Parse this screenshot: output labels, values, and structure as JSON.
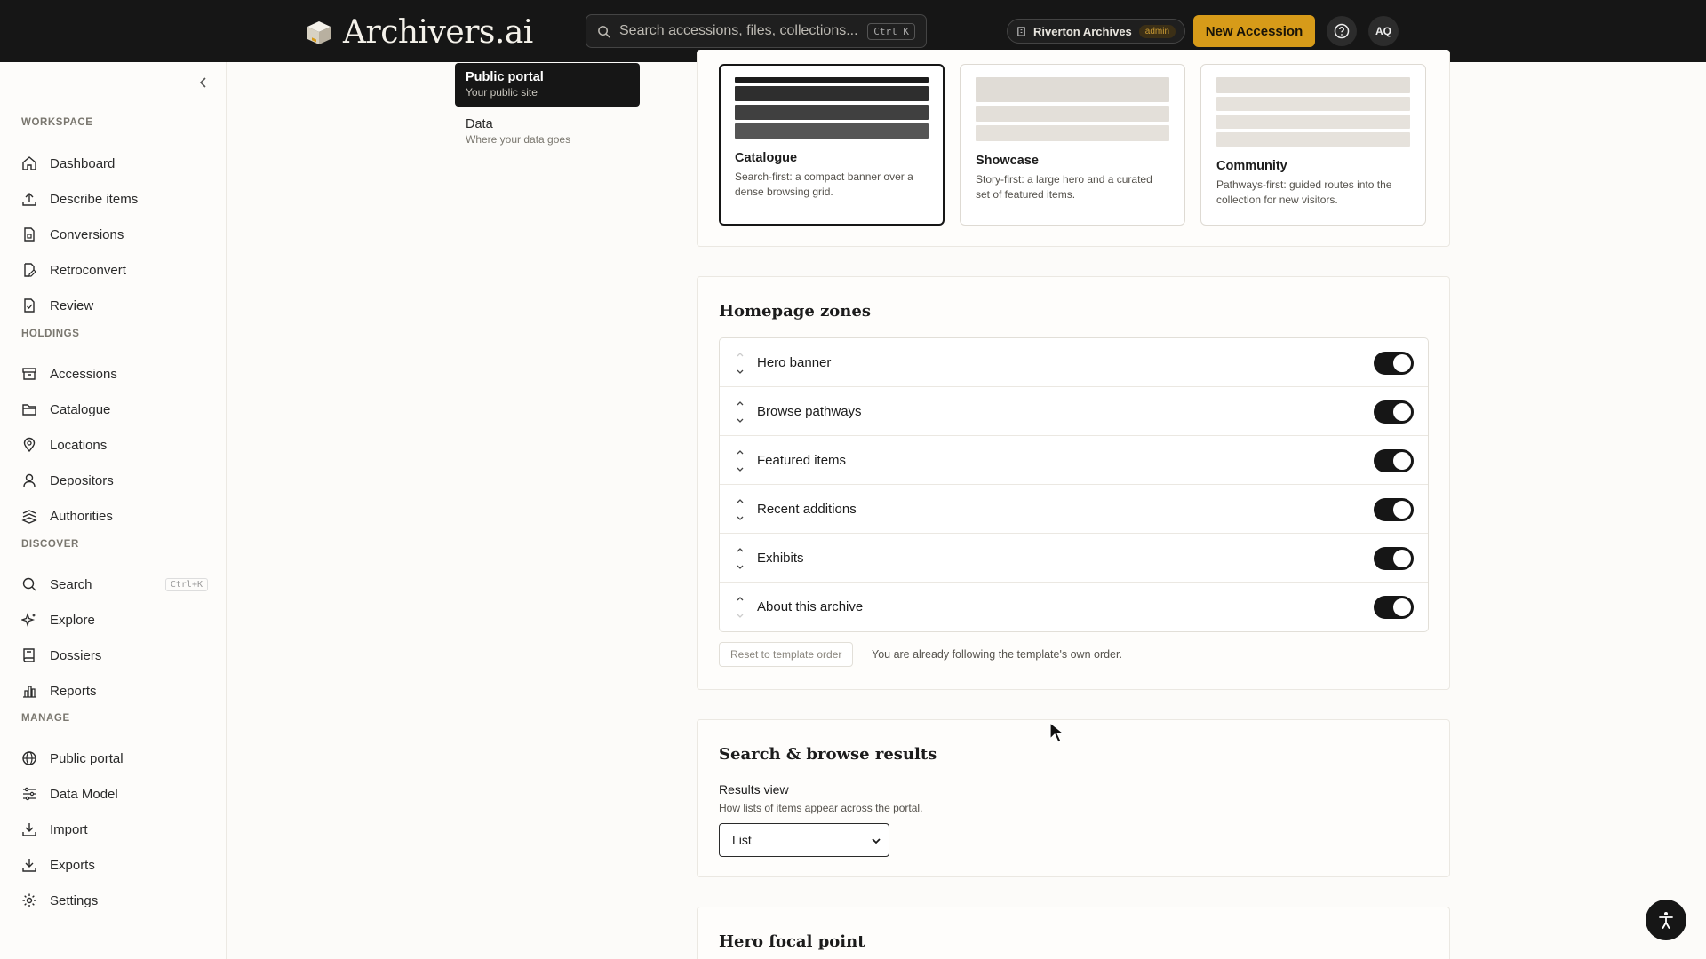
{
  "brand": {
    "name": "Archivers.ai"
  },
  "search": {
    "placeholder": "Search accessions, files, collections...",
    "shortcut": "Ctrl K"
  },
  "org": {
    "name": "Riverton Archives",
    "role": "admin"
  },
  "header": {
    "new_accession": "New Accession",
    "avatar_initials": "AQ"
  },
  "sidebar": {
    "sections": {
      "workspace": "WORKSPACE",
      "holdings": "HOLDINGS",
      "discover": "DISCOVER",
      "manage": "MANAGE"
    },
    "workspace": [
      "Dashboard",
      "Describe items",
      "Conversions",
      "Retroconvert",
      "Review"
    ],
    "holdings": [
      "Accessions",
      "Catalogue",
      "Locations",
      "Depositors",
      "Authorities"
    ],
    "discover": [
      "Search",
      "Explore",
      "Dossiers",
      "Reports"
    ],
    "discover_search_shortcut": "Ctrl+K",
    "manage": [
      "Public portal",
      "Data Model",
      "Import",
      "Exports",
      "Settings"
    ]
  },
  "subnav": [
    {
      "title": "Public portal",
      "subtitle": "Your public site",
      "active": true
    },
    {
      "title": "Data",
      "subtitle": "Where your data goes",
      "active": false
    }
  ],
  "templates": [
    {
      "name": "Catalogue",
      "description": "Search-first: a compact banner over a dense browsing grid.",
      "selected": true
    },
    {
      "name": "Showcase",
      "description": "Story-first: a large hero and a curated set of featured items.",
      "selected": false
    },
    {
      "name": "Community",
      "description": "Pathways-first: guided routes into the collection for new visitors.",
      "selected": false
    }
  ],
  "homepage_zones": {
    "title": "Homepage zones",
    "zones": [
      {
        "label": "Hero banner",
        "enabled": true
      },
      {
        "label": "Browse pathways",
        "enabled": true
      },
      {
        "label": "Featured items",
        "enabled": true
      },
      {
        "label": "Recent additions",
        "enabled": true
      },
      {
        "label": "Exhibits",
        "enabled": true
      },
      {
        "label": "About this archive",
        "enabled": true
      }
    ],
    "reset_label": "Reset to template order",
    "reset_note": "You are already following the template's own order."
  },
  "search_browse": {
    "title": "Search & browse results",
    "results_view_label": "Results view",
    "results_view_help": "How lists of items appear across the portal.",
    "results_view_value": "List"
  },
  "hero_focal": {
    "title": "Hero focal point"
  },
  "colors": {
    "accent": "#d79b19",
    "dark": "#161616"
  }
}
